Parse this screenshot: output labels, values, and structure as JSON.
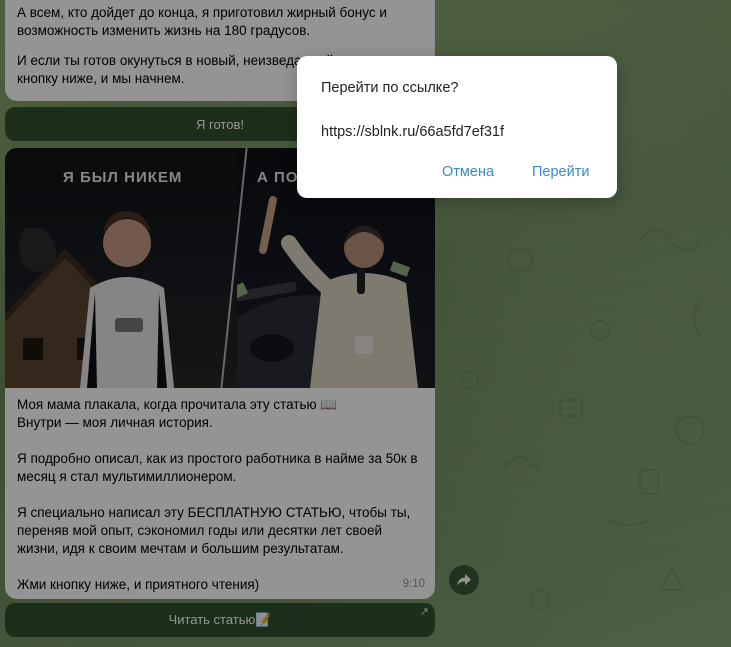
{
  "messages": {
    "top": {
      "paragraphs": [
        "А всем, кто дойдет до конца, я приготовил жирный бонус и возможность изменить жизнь на 180 градусов.",
        "И если ты готов окунуться в новый, неизведанный мир, то жми кнопку ниже, и мы начнем."
      ],
      "button_label": "Я готов!"
    },
    "bottom": {
      "image_caption_left": "Я БЫЛ НИКЕМ",
      "image_caption_right": "А ПОТОМ",
      "paragraphs": [
        "Моя мама плакала, когда прочитала эту статью 📖\nВнутри — моя личная история.",
        "Я подробно описал, как из простого работника в найме за 50к в месяц я стал мультимиллионером.",
        "Я специально написал эту БЕСПЛАТНУЮ СТАТЬЮ, чтобы ты, переняв мой опыт, сэкономил годы или десятки лет своей жизни, идя к своим мечтам и большим результатам.",
        "Жми кнопку ниже, и приятного чтения)"
      ],
      "time": "9:10",
      "button_label": "Читать статью📝",
      "button_icon": "external-arrow-icon"
    }
  },
  "dialog": {
    "title": "Перейти по ссылке?",
    "url": "https://sblnk.ru/66a5fd7ef31f",
    "cancel_label": "Отмена",
    "confirm_label": "Перейти"
  },
  "colors": {
    "link_button": "#3a8bc6",
    "chat_bg": "#6f8f5c",
    "inline_button": "#244424"
  }
}
